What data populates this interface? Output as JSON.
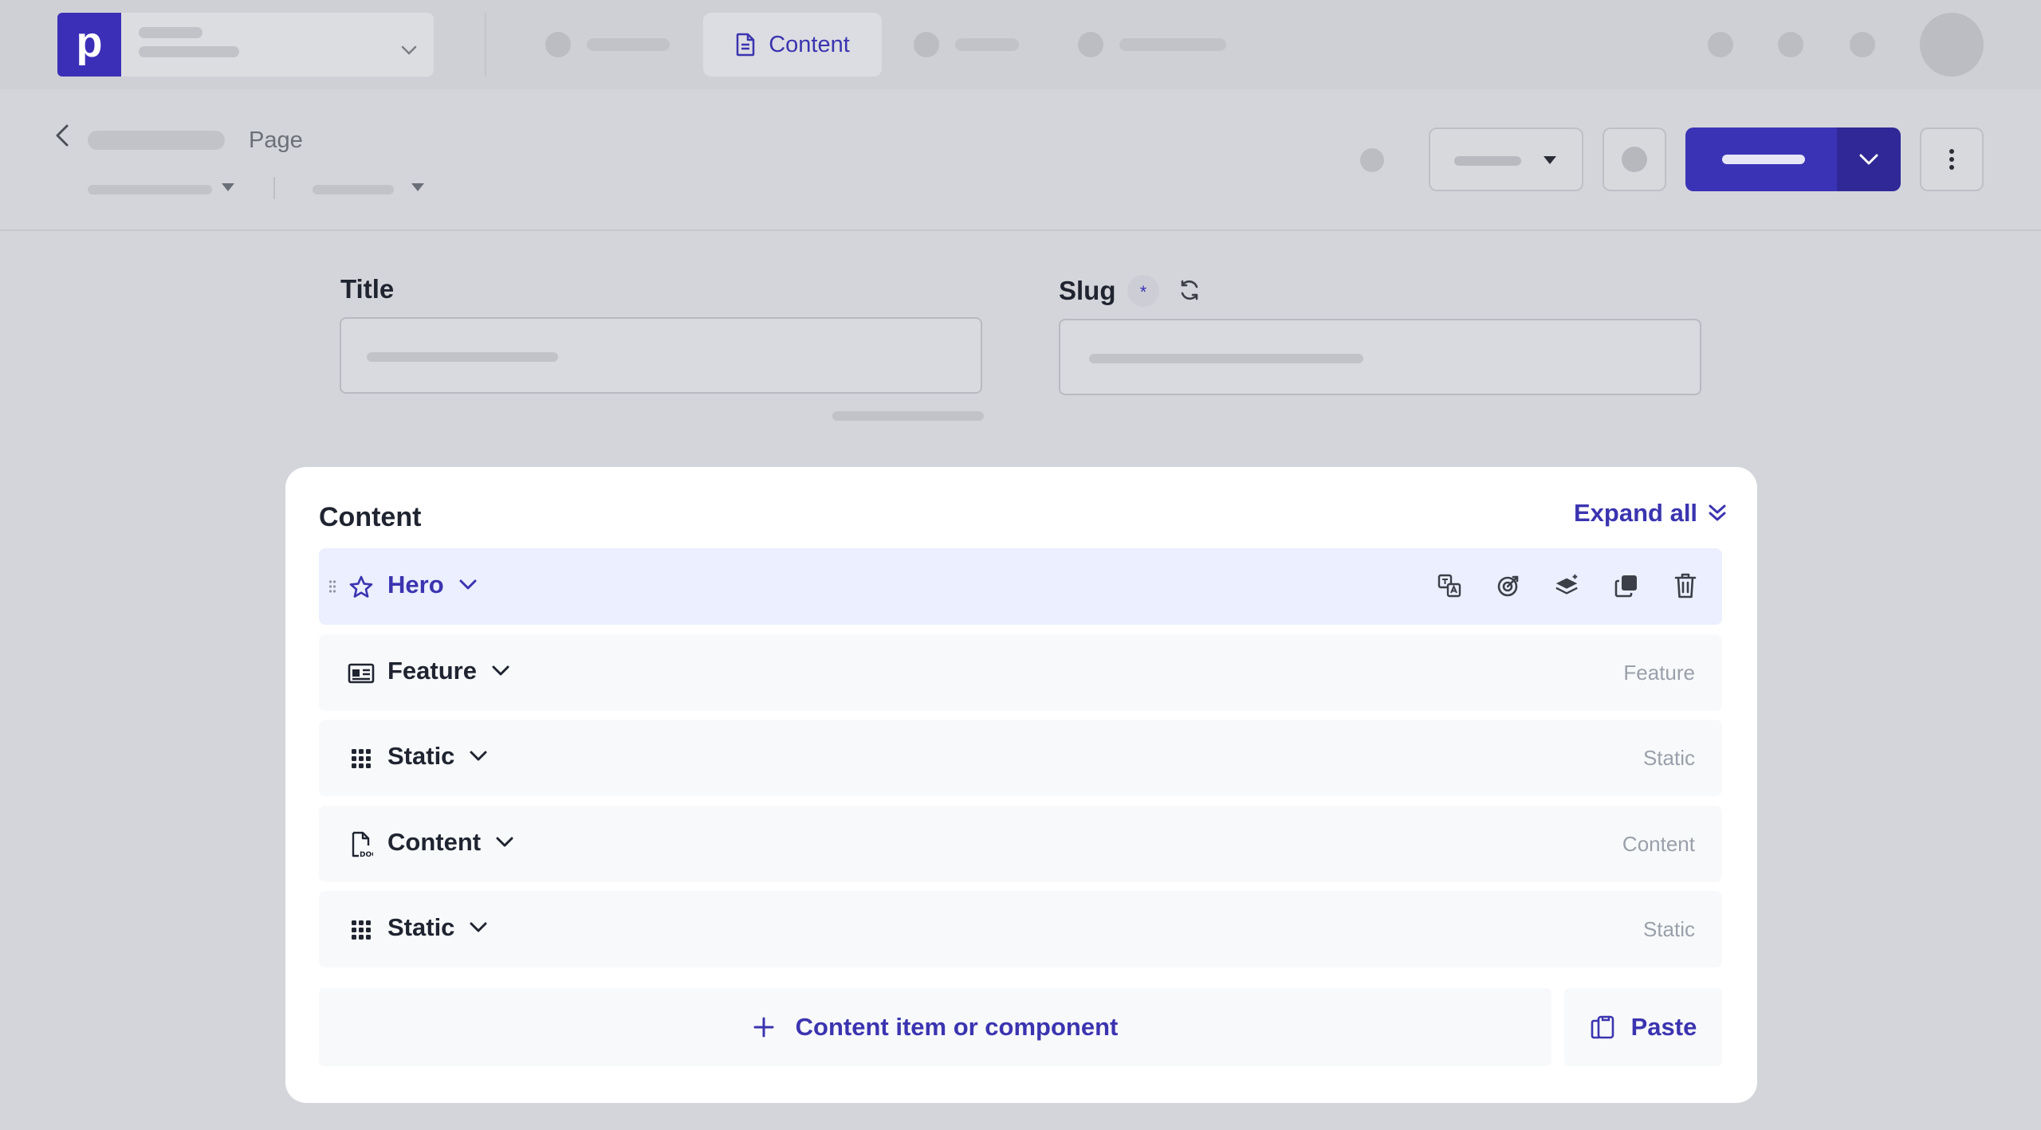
{
  "nav": {
    "logo_letter": "p",
    "active_tab": {
      "label": "Content",
      "icon": "document-icon"
    }
  },
  "header": {
    "page_label": "Page"
  },
  "fields": {
    "title_label": "Title",
    "slug_label": "Slug",
    "slug_required_mark": "*"
  },
  "content": {
    "title": "Content",
    "expand_all_label": "Expand all",
    "items": [
      {
        "label": "Hero",
        "type": "",
        "icon": "star-icon",
        "active": true
      },
      {
        "label": "Feature",
        "type": "Feature",
        "icon": "id-card-icon",
        "active": false
      },
      {
        "label": "Static",
        "type": "Static",
        "icon": "grid-icon",
        "active": false
      },
      {
        "label": "Content",
        "type": "Content",
        "icon": "doc-file-icon",
        "active": false
      },
      {
        "label": "Static",
        "type": "Static",
        "icon": "grid-icon",
        "active": false
      }
    ],
    "add_label": "Content item or component",
    "paste_label": "Paste"
  },
  "colors": {
    "brand": "#3b34b0",
    "active_row": "#ebefff",
    "overlay_bg": "#d4d5da"
  }
}
